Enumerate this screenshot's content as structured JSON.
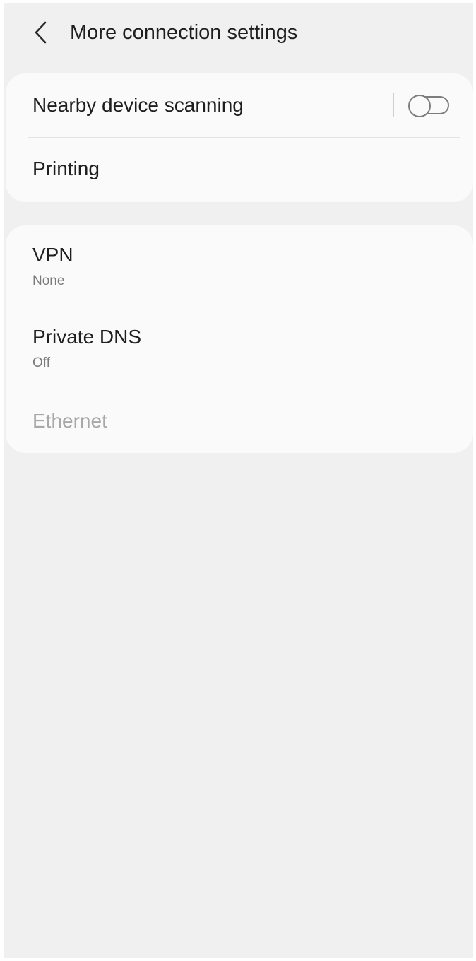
{
  "header": {
    "title": "More connection settings",
    "back_icon": "chevron-left-icon"
  },
  "group1": {
    "items": [
      {
        "label": "Nearby device scanning",
        "toggle": {
          "on": false
        }
      },
      {
        "label": "Printing"
      }
    ]
  },
  "group2": {
    "items": [
      {
        "label": "VPN",
        "subtitle": "None"
      },
      {
        "label": "Private DNS",
        "subtitle": "Off"
      },
      {
        "label": "Ethernet",
        "disabled": true
      }
    ]
  },
  "colors": {
    "background": "#f0f0f0",
    "card": "#fafafa",
    "text_primary": "#1e1e1e",
    "text_secondary": "#7a7a7a",
    "text_disabled": "#a8a8a8"
  }
}
